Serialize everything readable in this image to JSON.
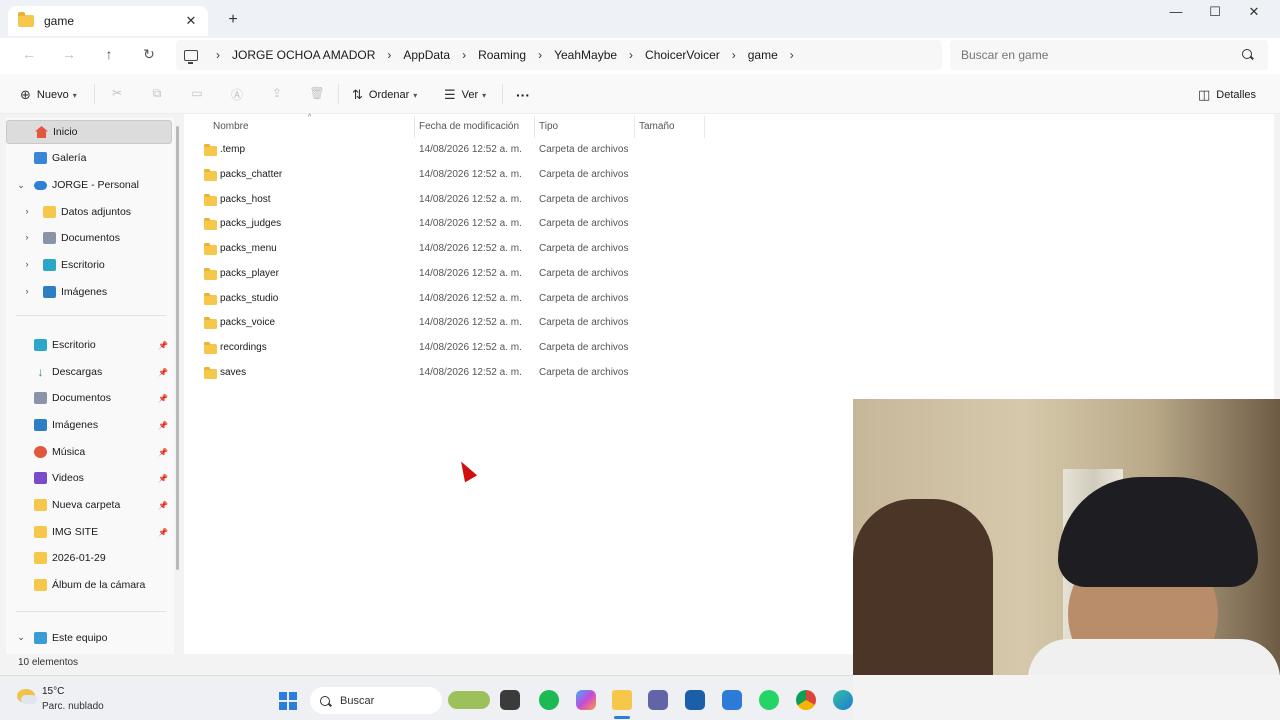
{
  "window": {
    "tab_title": "game",
    "tab_close": "✕",
    "new_tab": "+",
    "minimize": "—",
    "maximize": "☐",
    "close": "✕"
  },
  "navigation": {
    "back": "←",
    "forward": "→",
    "up": "↑",
    "refresh": "↻"
  },
  "breadcrumb": [
    "JORGE OCHOA AMADOR",
    "AppData",
    "Roaming",
    "YeahMaybe",
    "ChoicerVoicer",
    "game"
  ],
  "search": {
    "placeholder": "Buscar en game"
  },
  "toolbar": {
    "new_label": "Nuevo",
    "sort_label": "Ordenar",
    "view_label": "Ver",
    "more_label": "···",
    "details_label": "Detalles"
  },
  "sidebar": {
    "home": "Inicio",
    "gallery": "Galería",
    "onedrive": "JORGE - Personal",
    "onedrive_children": [
      "Datos adjuntos",
      "Documentos",
      "Escritorio",
      "Imágenes"
    ],
    "quick_access": [
      "Escritorio",
      "Descargas",
      "Documentos",
      "Imágenes",
      "Música",
      "Videos",
      "Nueva carpeta",
      "IMG SITE",
      "2026-01-29",
      "Álbum de la cámara"
    ],
    "this_pc": "Este equipo"
  },
  "columns": {
    "name": "Nombre",
    "modified": "Fecha de modificación",
    "type": "Tipo",
    "size": "Tamaño"
  },
  "files": [
    {
      "name": ".temp",
      "modified": "14/08/2026 12:52 a. m.",
      "type": "Carpeta de archivos"
    },
    {
      "name": "packs_chatter",
      "modified": "14/08/2026 12:52 a. m.",
      "type": "Carpeta de archivos"
    },
    {
      "name": "packs_host",
      "modified": "14/08/2026 12:52 a. m.",
      "type": "Carpeta de archivos"
    },
    {
      "name": "packs_judges",
      "modified": "14/08/2026 12:52 a. m.",
      "type": "Carpeta de archivos"
    },
    {
      "name": "packs_menu",
      "modified": "14/08/2026 12:52 a. m.",
      "type": "Carpeta de archivos"
    },
    {
      "name": "packs_player",
      "modified": "14/08/2026 12:52 a. m.",
      "type": "Carpeta de archivos"
    },
    {
      "name": "packs_studio",
      "modified": "14/08/2026 12:52 a. m.",
      "type": "Carpeta de archivos"
    },
    {
      "name": "packs_voice",
      "modified": "14/08/2026 12:52 a. m.",
      "type": "Carpeta de archivos"
    },
    {
      "name": "recordings",
      "modified": "14/08/2026 12:52 a. m.",
      "type": "Carpeta de archivos"
    },
    {
      "name": "saves",
      "modified": "14/08/2026 12:52 a. m.",
      "type": "Carpeta de archivos"
    }
  ],
  "status": {
    "item_count": "10 elementos"
  },
  "taskbar": {
    "temperature": "15°C",
    "weather": "Parc. nublado",
    "search_label": "Buscar"
  },
  "colors": {
    "folder": "#f5c84c",
    "accent": "#2b7de0",
    "cursor": "#d01010"
  }
}
